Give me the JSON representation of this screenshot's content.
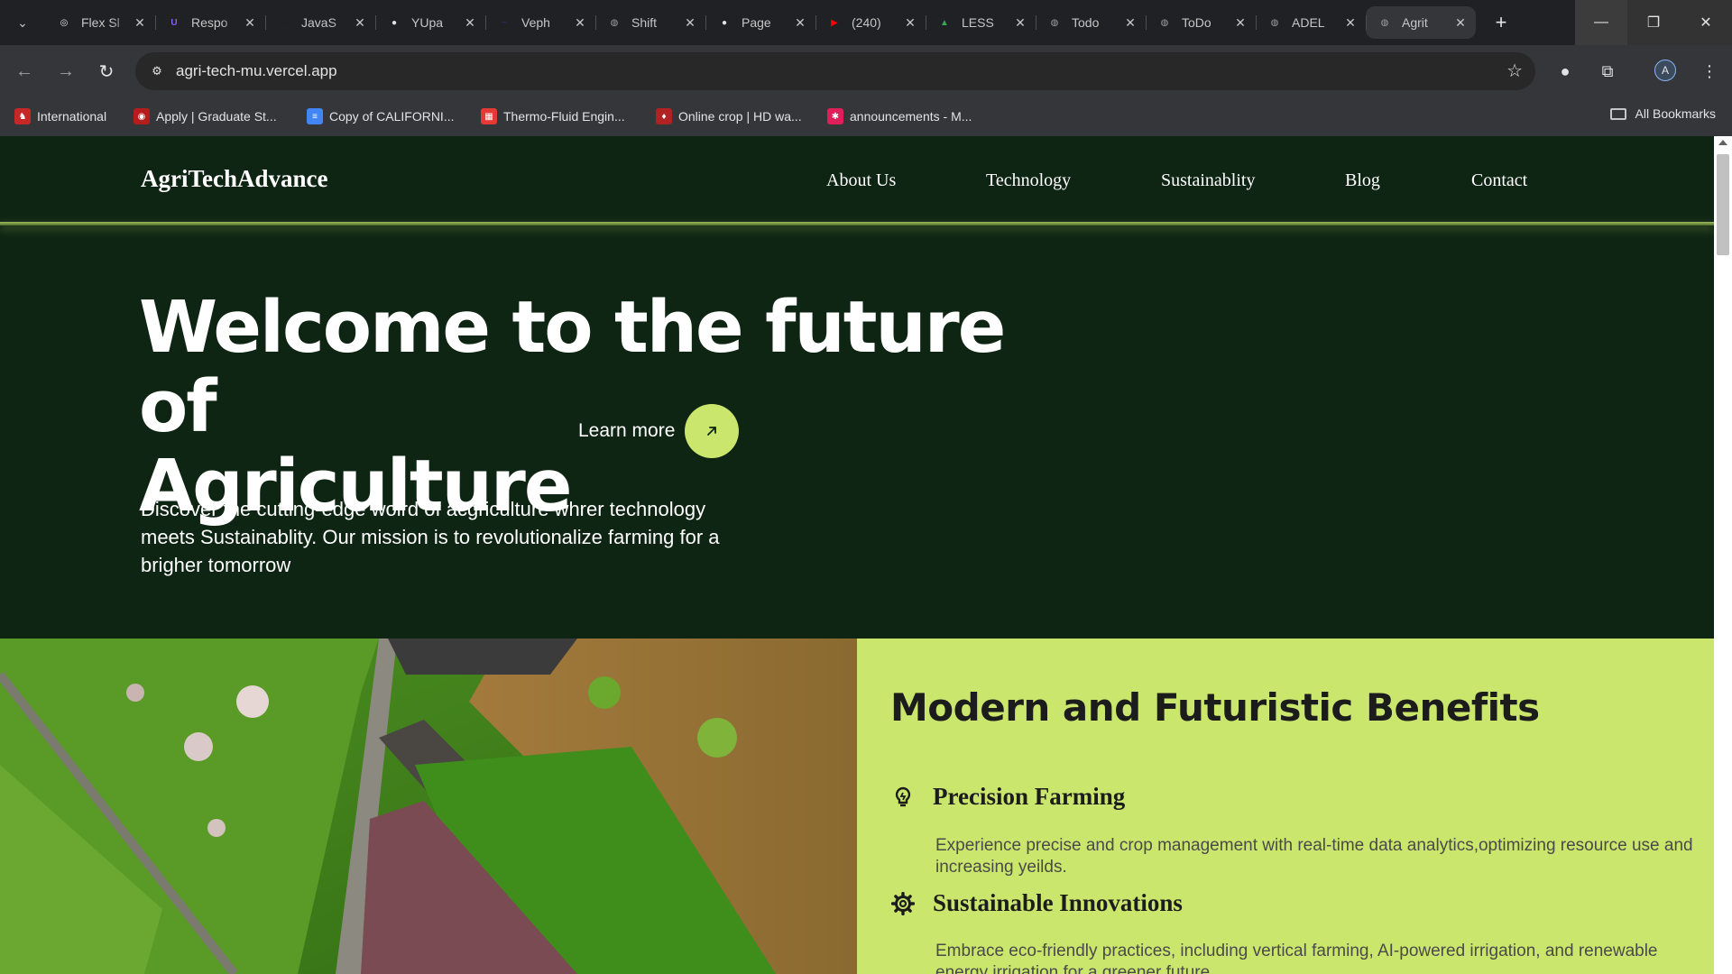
{
  "browser": {
    "tabs": [
      {
        "title": "Flex Sl",
        "favicon": "openai-icon",
        "color": "#e3e3e3",
        "glyph": "◎"
      },
      {
        "title": "Respo",
        "favicon": "responsive-app-icon",
        "color": "#8b5cf6",
        "glyph": "U"
      },
      {
        "title": "JavaS",
        "favicon": "m-logo-icon",
        "color": "#202124",
        "glyph": "M"
      },
      {
        "title": "YUpa",
        "favicon": "github-icon",
        "color": "#e3e3e3",
        "glyph": "●"
      },
      {
        "title": "Veph",
        "favicon": "veph-icon",
        "color": "#2a2a5a",
        "glyph": "~"
      },
      {
        "title": "Shift",
        "favicon": "globe-icon",
        "color": "#9aa0a6",
        "glyph": "◍"
      },
      {
        "title": "Page",
        "favicon": "github-icon",
        "color": "#e3e3e3",
        "glyph": "●"
      },
      {
        "title": "(240)",
        "favicon": "youtube-icon",
        "color": "#ff0000",
        "glyph": "▶"
      },
      {
        "title": "LESS",
        "favicon": "google-drive-icon",
        "color": "#34a853",
        "glyph": "▲"
      },
      {
        "title": "Todo",
        "favicon": "globe-icon",
        "color": "#9aa0a6",
        "glyph": "◍"
      },
      {
        "title": "ToDo",
        "favicon": "globe-icon",
        "color": "#9aa0a6",
        "glyph": "◍"
      },
      {
        "title": "ADEL",
        "favicon": "globe-icon",
        "color": "#9aa0a6",
        "glyph": "◍"
      },
      {
        "title": "Agrit",
        "favicon": "globe-icon",
        "color": "#9aa0a6",
        "glyph": "◍",
        "active": true
      }
    ],
    "url": "agri-tech-mu.vercel.app",
    "profile_initial": "A",
    "bookmarks": [
      {
        "label": "International",
        "color": "#c62828",
        "glyph": "♞"
      },
      {
        "label": "Apply | Graduate St...",
        "color": "#b71c1c",
        "glyph": "◉"
      },
      {
        "label": "Copy of CALIFORNI...",
        "color": "#4285f4",
        "glyph": "≡"
      },
      {
        "label": "Thermo-Fluid Engin...",
        "color": "#e53935",
        "glyph": "▦"
      },
      {
        "label": "Online crop | HD wa...",
        "color": "#b22222",
        "glyph": "♦"
      },
      {
        "label": "announcements - M...",
        "color": "#e01e5a",
        "glyph": "✱"
      }
    ],
    "all_bookmarks": "All Bookmarks"
  },
  "site": {
    "logo": "AgriTechAdvance",
    "nav": [
      "About Us",
      "Technology",
      "Sustainablity",
      "Blog",
      "Contact"
    ],
    "hero_line1": "Welcome to the future of",
    "hero_line2": "Agriculture",
    "learn_more": "Learn more",
    "description": "Discover the cutting-edge wolrd of acgriculture whrer technology meets Sustainablity. Our mission is to revolutionalize farming for a brigher tomorrow",
    "benefits_title": "Modern and Futuristic Benefits",
    "benefits": [
      {
        "name": "Precision Farming",
        "icon": "lightbulb-icon",
        "desc": "Experience precise and crop management with real-time data analytics,optimizing resource use and increasing yeilds."
      },
      {
        "name": "Sustainable Innovations",
        "icon": "gear-icon",
        "desc": "Embrace eco-friendly practices, including vertical farming, AI-powered irrigation, and renewable energy irrigation for a greener future."
      }
    ],
    "colors": {
      "primary_dark": "#0f2514",
      "accent_lime": "#cbe66c",
      "text_light": "#ffffff",
      "text_dark": "#1c1c1c"
    }
  }
}
